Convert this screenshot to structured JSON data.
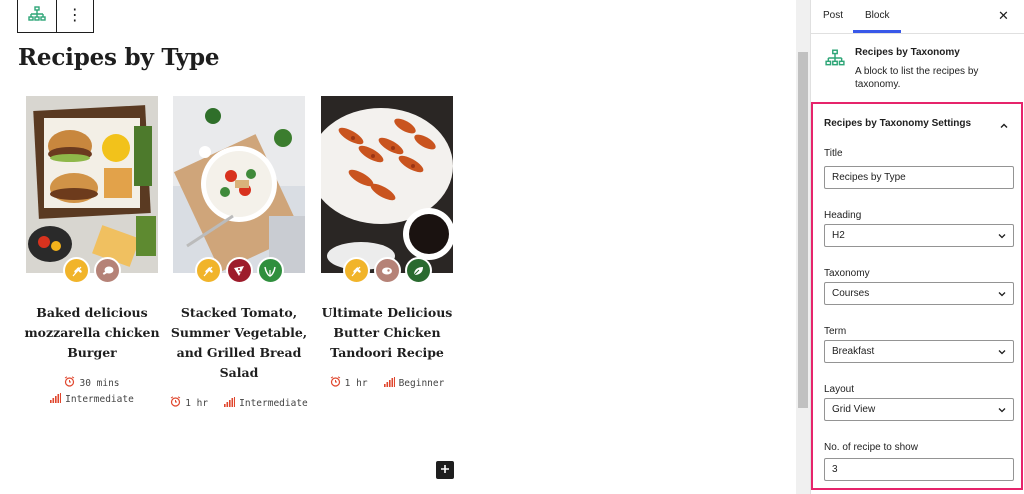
{
  "toolbar": {
    "block_icon": "sitemap-icon",
    "more_icon": "more-vertical-icon",
    "more_label": "⋮"
  },
  "page": {
    "title": "Recipes by Type"
  },
  "recipes": [
    {
      "title": "Baked delicious mozzarella chicken Burger",
      "badges": [
        "wheat-icon",
        "chicken-leg-icon"
      ],
      "time": "30 mins",
      "difficulty": "Intermediate"
    },
    {
      "title": "Stacked Tomato, Summer Vegetable, and Grilled Bread Salad",
      "badges": [
        "wheat-icon",
        "pizza-icon",
        "leaf-icon"
      ],
      "time": "1 hr",
      "difficulty": "Intermediate"
    },
    {
      "title": "Ultimate Delicious Butter Chicken Tandoori Recipe",
      "badges": [
        "wheat-icon",
        "meat-icon",
        "vegan-leaf-icon"
      ],
      "time": "1 hr",
      "difficulty": "Beginner"
    }
  ],
  "colors": {
    "accent": "#3858e9",
    "highlight": "#e6246b",
    "meta_icon": "#e0452c",
    "badge_wheat": "#f1b42a",
    "badge_meat": "#b58277",
    "badge_pizza": "#9d1c2b",
    "badge_leaf": "#2f8f3d",
    "badge_vegan": "#2a6a2f"
  },
  "sidebar": {
    "tabs": [
      "Post",
      "Block"
    ],
    "active_tab": "Block",
    "close_label": "✕",
    "block_card": {
      "title": "Recipes by Taxonomy",
      "description": "A block to list the recipes by taxonomy."
    },
    "panel": {
      "title": "Recipes by Taxonomy Settings",
      "fields": {
        "title": {
          "label": "Title",
          "value": "Recipes by Type"
        },
        "heading": {
          "label": "Heading",
          "value": "H2"
        },
        "taxonomy": {
          "label": "Taxonomy",
          "value": "Courses"
        },
        "term": {
          "label": "Term",
          "value": "Breakfast"
        },
        "layout": {
          "label": "Layout",
          "value": "Grid View"
        },
        "count": {
          "label": "No. of recipe to show",
          "value": "3"
        }
      }
    }
  }
}
